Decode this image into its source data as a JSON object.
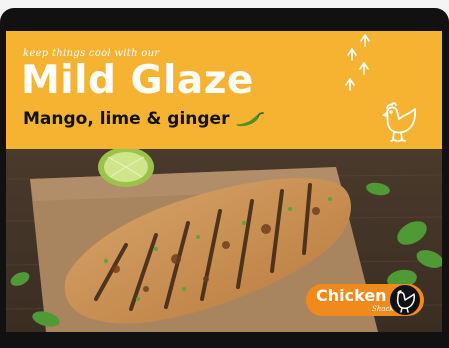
{
  "ad": {
    "tagline": "keep things cool with our",
    "headline": "Mild Glaze",
    "subhead": "Mango, lime & ginger"
  },
  "logo": {
    "wordmark": "Chicken",
    "subtext": "Shack",
    "icon": "hen-icon"
  },
  "icons": [
    "chili-icon",
    "footprints-icon",
    "hen-icon",
    "lime-icon"
  ],
  "colors": {
    "banner": "#f6b332",
    "logo_pill": "#f08a1c",
    "chili": "#4f8f2a",
    "device": "#111111"
  }
}
